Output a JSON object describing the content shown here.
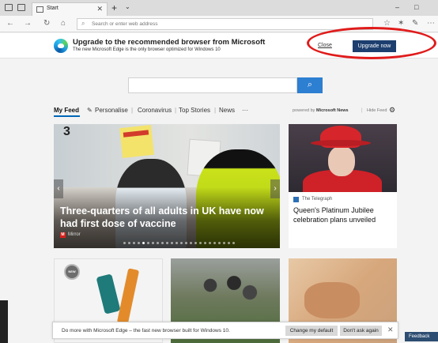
{
  "browser": {
    "tab_title": "Start",
    "tab_close": "✕",
    "new_tab": "+",
    "tab_menu": "⌄",
    "window_minimize": "–",
    "window_restore": "□",
    "address_placeholder": "Search or enter web address"
  },
  "banner": {
    "title": "Upgrade to the recommended browser from Microsoft",
    "subtitle": "The new Microsoft Edge is the only browser optimized for Windows 10",
    "close_label": "Close",
    "upgrade_label": "Upgrade now",
    "annotation_color": "#e01b1b"
  },
  "search": {
    "button_icon": "search-icon"
  },
  "feed_nav": {
    "items": [
      "My Feed",
      "Personalise",
      "Coronavirus",
      "Top Stories",
      "News",
      "···"
    ],
    "powered_by": "powered by",
    "powered_brand": "Microsoft News",
    "hide_feed": "Hide Feed"
  },
  "hero": {
    "number": "3",
    "title": "Three-quarters of all adults in UK have now had first dose of vaccine",
    "source_logo": "M",
    "source": "Mirror",
    "prev_arrow": "‹",
    "next_arrow": "›"
  },
  "side_story": {
    "source": "The Telegraph",
    "title": "Queen's Platinum Jubilee celebration plans unveiled"
  },
  "bottom_cards": {
    "badge": "NEW"
  },
  "notification": {
    "text": "Do more with Microsoft Edge – the fast new browser built for Windows 10.",
    "change_default": "Change my default",
    "dont_ask": "Don't ask again",
    "close": "✕"
  },
  "feedback": {
    "label": "Feedback"
  },
  "colors": {
    "accent": "#0067b8",
    "upgrade_button": "#1d3f6f",
    "search_button": "#2d7fd2"
  }
}
